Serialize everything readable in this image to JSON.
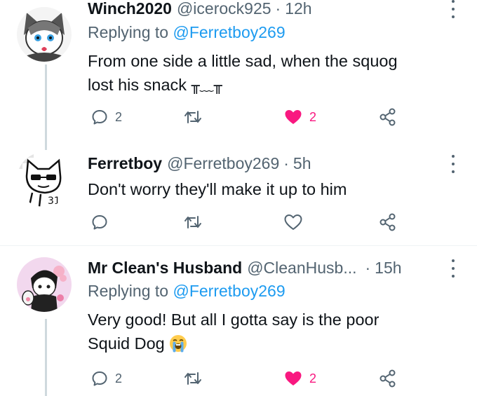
{
  "tweets": [
    {
      "name": "Winch2020",
      "handle": "@icerock925",
      "dot": "·",
      "time": "12h",
      "replying_label": "Replying to",
      "replying_handle": "@Ferretboy269",
      "text_line1": "From one side a little sad, when the squog",
      "text_line2": "lost his snack",
      "kaomoji": "╥﹏╥",
      "reply_count": "2",
      "retweet_count": "",
      "like_count": "2",
      "liked": true
    },
    {
      "name": "Ferretboy",
      "handle": "@Ferretboy269",
      "dot": "·",
      "time": "5h",
      "text_line1": "Don't worry they'll make it up to him",
      "reply_count": "",
      "retweet_count": "",
      "like_count": "",
      "liked": false
    },
    {
      "name": "Mr Clean's Husband",
      "handle": "@CleanHusb...",
      "dot": "·",
      "time": "15h",
      "replying_label": "Replying to",
      "replying_handle": "@Ferretboy269",
      "text_line1": "Very good! But all I gotta say is the poor",
      "text_line2": "Squid Dog",
      "emoji": "loudly-crying-face",
      "reply_count": "2",
      "retweet_count": "",
      "like_count": "2",
      "liked": true
    }
  ],
  "colors": {
    "text": "#0f1419",
    "secondary": "#536471",
    "link": "#1d9bf0",
    "like": "#f91880",
    "thread_line": "#cfd9de",
    "divider": "#eff3f4"
  },
  "icons": [
    "reply-icon",
    "retweet-icon",
    "like-icon",
    "share-icon",
    "more-icon"
  ]
}
